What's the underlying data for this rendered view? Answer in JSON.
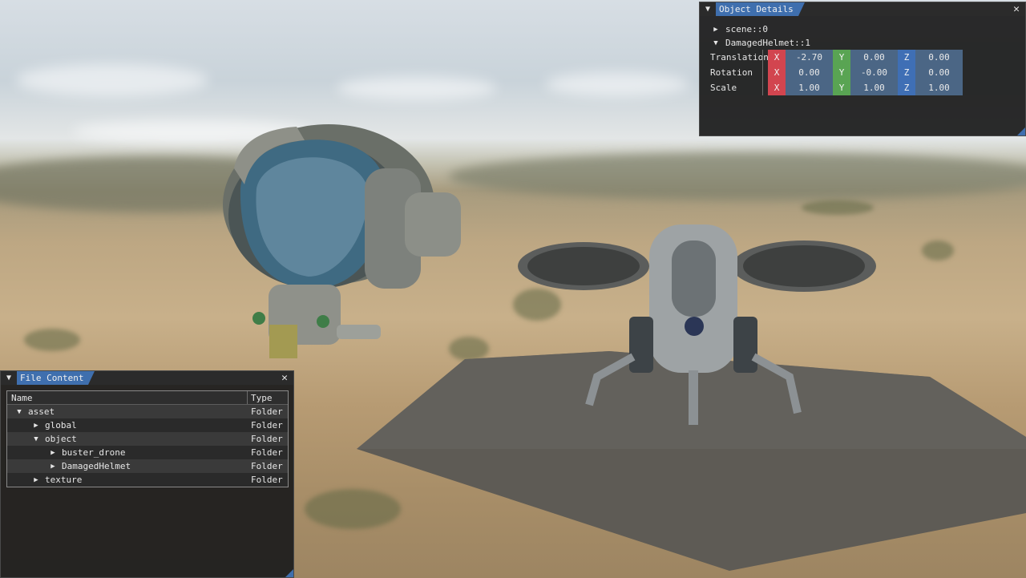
{
  "object_details": {
    "title": "Object Details",
    "close_glyph": "✕",
    "collapse_glyph": "▼",
    "tree": [
      {
        "label": "scene::0",
        "arrow": "▶"
      },
      {
        "label": "DamagedHelmet::1",
        "arrow": "▼"
      }
    ],
    "properties": [
      {
        "label": "Translation",
        "x": "-2.70",
        "y": "0.00",
        "z": "0.00"
      },
      {
        "label": "Rotation",
        "x": "0.00",
        "y": "-0.00",
        "z": "0.00"
      },
      {
        "label": "Scale",
        "x": "1.00",
        "y": "1.00",
        "z": "1.00"
      }
    ],
    "axis_labels": {
      "x": "X",
      "y": "Y",
      "z": "Z"
    }
  },
  "file_content": {
    "title": "File Content",
    "close_glyph": "✕",
    "collapse_glyph": "▼",
    "columns": {
      "name": "Name",
      "type": "Type"
    },
    "rows": [
      {
        "name": "asset",
        "type": "Folder",
        "arrow": "▼"
      },
      {
        "name": "global",
        "type": "Folder",
        "arrow": "▶"
      },
      {
        "name": "object",
        "type": "Folder",
        "arrow": "▼"
      },
      {
        "name": "buster_drone",
        "type": "Folder",
        "arrow": "▶"
      },
      {
        "name": "DamagedHelmet",
        "type": "Folder",
        "arrow": "▶"
      },
      {
        "name": "texture",
        "type": "Folder",
        "arrow": "▶"
      }
    ]
  },
  "colors": {
    "accent": "#3f6fae",
    "axis_x": "#d2454f",
    "axis_y": "#59a453",
    "axis_z": "#3f6fb5",
    "field_bg": "#4b6685"
  }
}
